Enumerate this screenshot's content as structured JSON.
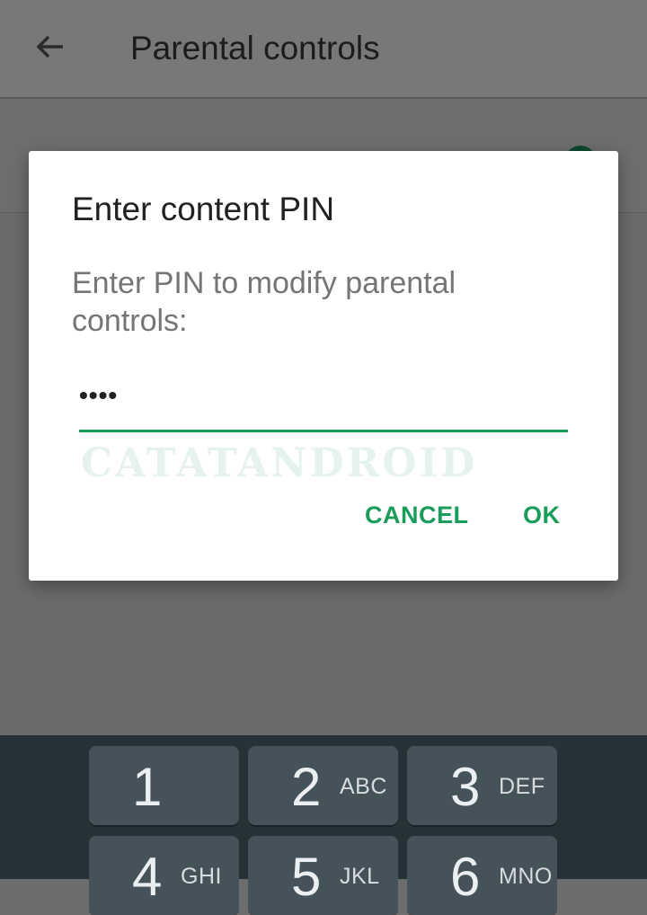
{
  "app_bar": {
    "title": "Parental controls",
    "back_icon": "arrow-back-icon"
  },
  "dialog": {
    "title": "Enter content PIN",
    "message": "Enter PIN to modify parental controls:",
    "pin_value": "••••",
    "watermark": "CATATANDROID",
    "cancel_label": "CANCEL",
    "ok_label": "OK",
    "accent_color": "#1a9c5b"
  },
  "keypad": {
    "keys": [
      {
        "num": "1",
        "letters": ""
      },
      {
        "num": "2",
        "letters": "ABC"
      },
      {
        "num": "3",
        "letters": "DEF"
      },
      {
        "num": "4",
        "letters": "GHI"
      },
      {
        "num": "5",
        "letters": "JKL"
      },
      {
        "num": "6",
        "letters": "MNO"
      }
    ]
  }
}
